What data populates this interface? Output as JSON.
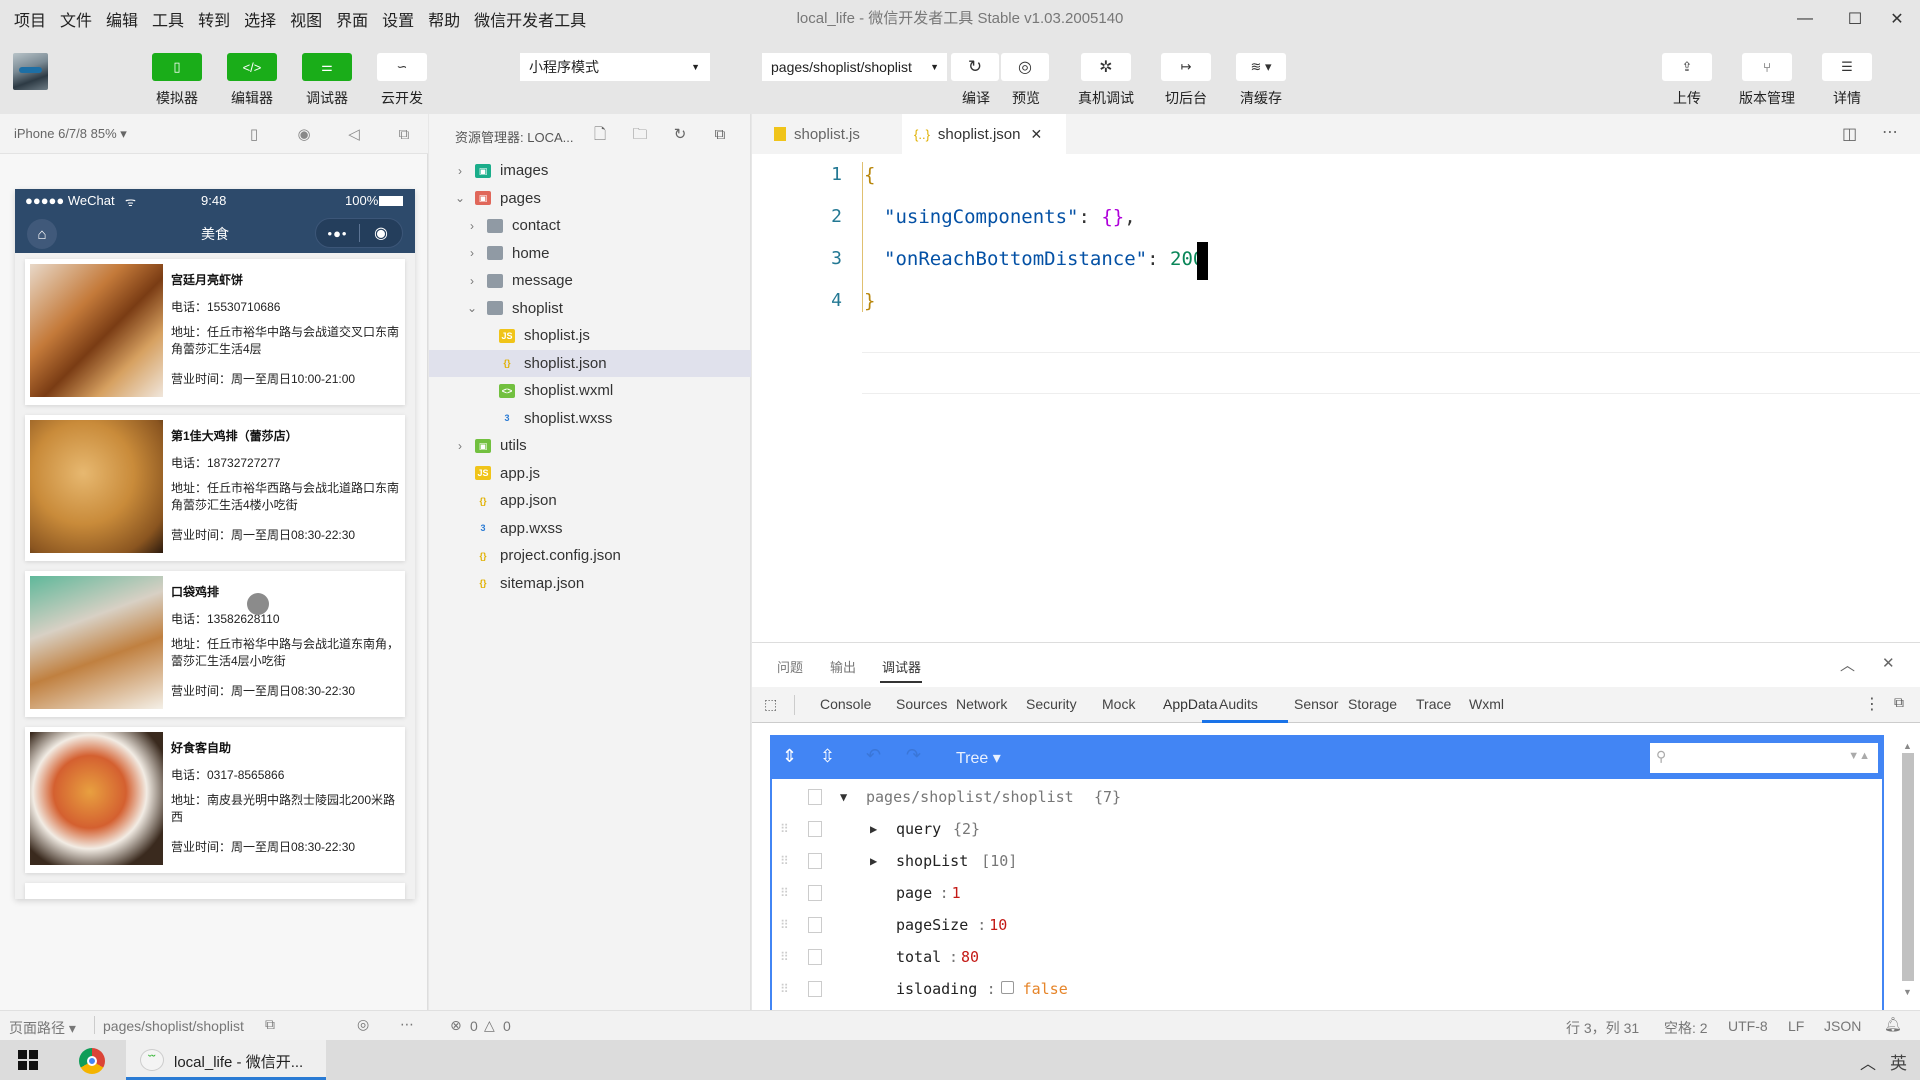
{
  "window": {
    "title": "local_life - 微信开发者工具 Stable v1.03.2005140",
    "minimize_icon": "minimize-icon",
    "maximize_icon": "maximize-icon",
    "close_icon": "close-icon"
  },
  "menubar": [
    "项目",
    "文件",
    "编辑",
    "工具",
    "转到",
    "选择",
    "视图",
    "界面",
    "设置",
    "帮助",
    "微信开发者工具"
  ],
  "toolbar": {
    "simulator": "模拟器",
    "editor": "编辑器",
    "debugger": "调试器",
    "cloud": "云开发",
    "mode_select": "小程序模式",
    "page_select": "pages/shoplist/shoplist",
    "compile": "编译",
    "preview": "预览",
    "remote_debug": "真机调试",
    "background": "切后台",
    "clear_cache": "清缓存",
    "upload": "上传",
    "version": "版本管理",
    "details": "详情"
  },
  "simulator": {
    "device": "iPhone 6/7/8 85%",
    "status": {
      "carrier": "●●●●● WeChat",
      "time": "9:48",
      "battery": "100%"
    },
    "nav_title": "美食",
    "shops": [
      {
        "name": "宫廷月亮虾饼",
        "tel": "电话：15530710686",
        "addr": "地址：任丘市裕华中路与会战道交叉口东南角蕾莎汇生活4层",
        "hours": "营业时间：周一至周日10:00-21:00"
      },
      {
        "name": "第1佳大鸡排（蕾莎店）",
        "tel": "电话：18732727277",
        "addr": "地址：任丘市裕华西路与会战北道路口东南角蕾莎汇生活4楼小吃街",
        "hours": "营业时间：周一至周日08:30-22:30"
      },
      {
        "name": "口袋鸡排",
        "tel": "电话：13582628110",
        "addr": "地址：任丘市裕华中路与会战北道东南角，蕾莎汇生活4层小吃街",
        "hours": "营业时间：周一至周日08:30-22:30"
      },
      {
        "name": "好食客自助",
        "tel": "电话：0317-8565866",
        "addr": "地址：南皮县光明中路烈士陵园北200米路西",
        "hours": "营业时间：周一至周日08:30-22:30"
      }
    ]
  },
  "explorer": {
    "title": "资源管理器: LOCA...",
    "tree": [
      {
        "label": "images",
        "depth": 0,
        "chevron": "›",
        "icon": "folder-images"
      },
      {
        "label": "pages",
        "depth": 0,
        "chevron": "⌄",
        "icon": "folder-pages"
      },
      {
        "label": "contact",
        "depth": 1,
        "chevron": "›",
        "icon": "folder"
      },
      {
        "label": "home",
        "depth": 1,
        "chevron": "›",
        "icon": "folder"
      },
      {
        "label": "message",
        "depth": 1,
        "chevron": "›",
        "icon": "folder"
      },
      {
        "label": "shoplist",
        "depth": 1,
        "chevron": "⌄",
        "icon": "folder-open"
      },
      {
        "label": "shoplist.js",
        "depth": 2,
        "chevron": "",
        "icon": "js"
      },
      {
        "label": "shoplist.json",
        "depth": 2,
        "chevron": "",
        "icon": "json",
        "active": true
      },
      {
        "label": "shoplist.wxml",
        "depth": 2,
        "chevron": "",
        "icon": "wxml"
      },
      {
        "label": "shoplist.wxss",
        "depth": 2,
        "chevron": "",
        "icon": "wxss"
      },
      {
        "label": "utils",
        "depth": 0,
        "chevron": "›",
        "icon": "folder-utils"
      },
      {
        "label": "app.js",
        "depth": 0,
        "chevron": "",
        "icon": "js"
      },
      {
        "label": "app.json",
        "depth": 0,
        "chevron": "",
        "icon": "json"
      },
      {
        "label": "app.wxss",
        "depth": 0,
        "chevron": "",
        "icon": "wxss"
      },
      {
        "label": "project.config.json",
        "depth": 0,
        "chevron": "",
        "icon": "json"
      },
      {
        "label": "sitemap.json",
        "depth": 0,
        "chevron": "",
        "icon": "json"
      }
    ]
  },
  "editor": {
    "tabs": [
      {
        "label": "shoplist.js",
        "active": false
      },
      {
        "label": "shoplist.json",
        "active": true
      }
    ],
    "lines": [
      {
        "n": "1",
        "text": "{"
      },
      {
        "n": "2",
        "key": "\"usingComponents\"",
        "sep": ": ",
        "val": "{}",
        "tail": ","
      },
      {
        "n": "3",
        "key": "\"onReachBottomDistance\"",
        "sep": ": ",
        "val": "200",
        "tail": ""
      },
      {
        "n": "4",
        "text": "}"
      }
    ]
  },
  "debugger": {
    "panel_tabs": [
      "问题",
      "输出",
      "调试器"
    ],
    "active_panel": "调试器",
    "devtools_tabs": [
      "Console",
      "Sources",
      "Network",
      "Security",
      "Mock",
      "AppData",
      "Audits",
      "Sensor",
      "Storage",
      "Trace",
      "Wxml"
    ],
    "active_devtools_tab": "AppData",
    "appdata": {
      "mode": "Tree ▾",
      "search_placeholder": "",
      "root": {
        "label": "pages/shoplist/shoplist",
        "count": "{7}"
      },
      "rows": [
        {
          "key": "query",
          "meta": "{2}",
          "expandable": true
        },
        {
          "key": "shopList",
          "meta": "[10]",
          "expandable": true
        },
        {
          "key": "page",
          "value": "1",
          "type": "number"
        },
        {
          "key": "pageSize",
          "value": "10",
          "type": "number"
        },
        {
          "key": "total",
          "value": "80",
          "type": "number"
        },
        {
          "key": "isloading",
          "value": "false",
          "type": "boolean"
        }
      ]
    }
  },
  "statusbar": {
    "page_path_label": "页面路径 ▾",
    "page_path": "pages/shoplist/shoplist",
    "errors": "0",
    "warnings": "0",
    "position": "行 3，列 31",
    "indent": "空格: 2",
    "encoding": "UTF-8",
    "eol": "LF",
    "language": "JSON"
  },
  "taskbar": {
    "app_label": "local_life - 微信开...",
    "ime": "英"
  },
  "colors": {
    "wechat_green": "#1aad19",
    "nav_blue": "#2d4a6b",
    "appdata_blue": "#4285f4",
    "active_tab_underline": "#1a73e8"
  }
}
